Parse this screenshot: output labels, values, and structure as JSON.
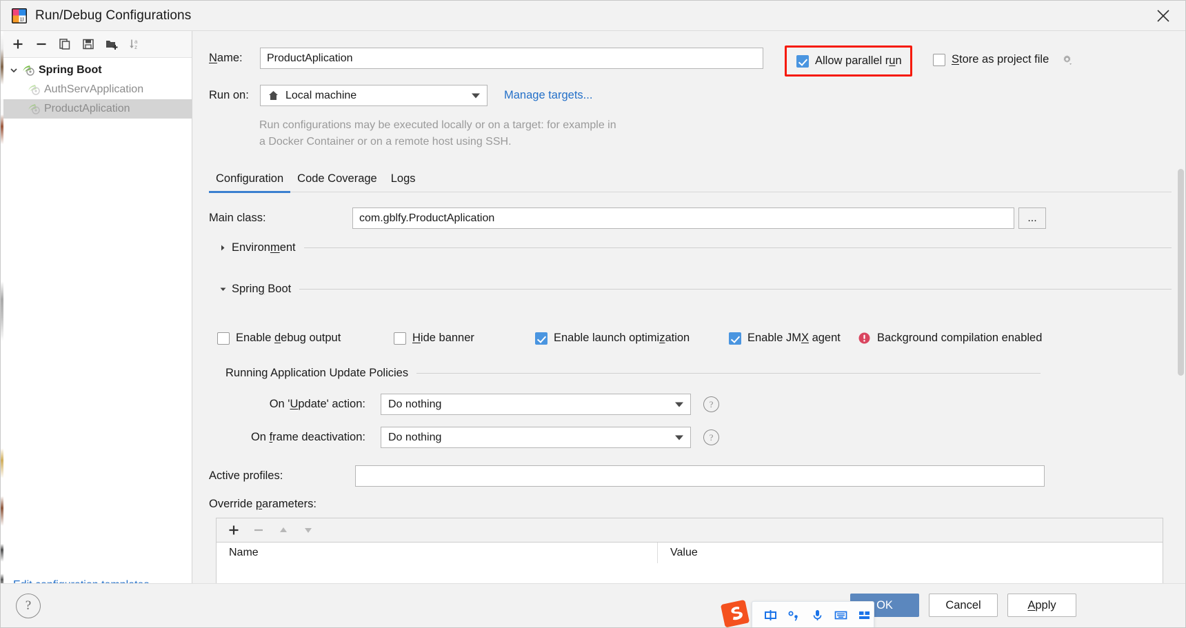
{
  "window": {
    "title": "Run/Debug Configurations",
    "app_icon": "intellij-idea-icon",
    "close_icon": "close-icon"
  },
  "left_panel": {
    "toolbar": [
      {
        "name": "add-configuration-button",
        "icon": "plus-icon"
      },
      {
        "name": "remove-configuration-button",
        "icon": "minus-icon"
      },
      {
        "name": "copy-configuration-button",
        "icon": "copy-icon"
      },
      {
        "name": "save-configuration-button",
        "icon": "save-icon"
      },
      {
        "name": "create-folder-button",
        "icon": "folder-add-icon"
      },
      {
        "name": "sort-configurations-button",
        "icon": "sort-alpha-icon"
      }
    ],
    "tree": [
      {
        "label": "Spring Boot",
        "level": 0,
        "bold": true,
        "expanded": true,
        "selected": false,
        "icon": "spring-boot-icon"
      },
      {
        "label": "AuthServApplication",
        "level": 1,
        "bold": false,
        "selected": false,
        "icon": "spring-boot-icon"
      },
      {
        "label": "ProductAplication",
        "level": 1,
        "bold": false,
        "selected": true,
        "icon": "spring-boot-icon"
      }
    ],
    "edit_templates_link": "Edit configuration templates..."
  },
  "form": {
    "name_label": "Name:",
    "name_value": "ProductAplication",
    "allow_parallel_run": {
      "label": "Allow parallel run",
      "checked": true,
      "highlight_color": "#f61a0a"
    },
    "store_as_project_file": {
      "label": "Store as project file",
      "checked": false,
      "gear_icon": "gear-dropdown-icon"
    },
    "run_on_label": "Run on:",
    "run_on_value": "Local machine",
    "run_on_icon": "home-icon",
    "manage_targets_link": "Manage targets...",
    "hint_text": "Run configurations may be executed locally or on a target: for example in a Docker Container or on a remote host using SSH."
  },
  "tabs": [
    {
      "label": "Configuration",
      "active": true
    },
    {
      "label": "Code Coverage",
      "active": false
    },
    {
      "label": "Logs",
      "active": false
    }
  ],
  "configuration": {
    "main_class_label": "Main class:",
    "main_class_value": "com.gblfy.ProductAplication",
    "browse_button_label": "...",
    "environment_section": {
      "title": "Environment",
      "expanded": false
    },
    "spring_boot_section": {
      "title": "Spring Boot",
      "expanded": true
    },
    "checkboxes": [
      {
        "name": "enable-debug-output",
        "label": "Enable debug output",
        "underline_index": 7,
        "checked": false
      },
      {
        "name": "hide-banner",
        "label": "Hide banner",
        "underline_index": 0,
        "checked": false
      },
      {
        "name": "enable-launch-optimization",
        "label": "Enable launch optimization",
        "underline_index": 20,
        "checked": true
      },
      {
        "name": "enable-jmx-agent",
        "label": "Enable JMX agent",
        "underline_index": 10,
        "checked": true
      }
    ],
    "background_compilation": {
      "text": "Background compilation enabled",
      "icon": "error-warning-icon",
      "icon_color": "#d9455f"
    },
    "update_policies": {
      "section_title": "Running Application Update Policies",
      "rows": [
        {
          "label": "On 'Update' action:",
          "value": "Do nothing",
          "help_icon": "question-icon"
        },
        {
          "label": "On frame deactivation:",
          "value": "Do nothing",
          "help_icon": "question-icon"
        }
      ]
    },
    "active_profiles_label": "Active profiles:",
    "active_profiles_value": "",
    "override_parameters_label": "Override parameters:",
    "override_table": {
      "toolbar": [
        {
          "name": "add-parameter-button",
          "icon": "plus-icon",
          "enabled": true
        },
        {
          "name": "remove-parameter-button",
          "icon": "minus-icon",
          "enabled": false
        },
        {
          "name": "move-up-button",
          "icon": "arrow-up-icon",
          "enabled": false
        },
        {
          "name": "move-down-button",
          "icon": "arrow-down-icon",
          "enabled": false
        }
      ],
      "columns": [
        "Name",
        "Value"
      ],
      "rows": []
    }
  },
  "footer": {
    "help_label": "?",
    "ok_label": "OK",
    "cancel_label": "Cancel",
    "apply_label": "Apply",
    "ok_color": "#5b87be"
  },
  "ime_overlay": {
    "logo_icon": "sogou-logo-icon",
    "buttons": [
      {
        "name": "ime-mode-icon",
        "icon": "chinese-input-icon"
      },
      {
        "name": "ime-punctuation-icon",
        "icon": "punctuation-icon"
      },
      {
        "name": "ime-voice-icon",
        "icon": "microphone-icon"
      },
      {
        "name": "ime-keyboard-icon",
        "icon": "keyboard-icon"
      },
      {
        "name": "ime-toolbox-icon",
        "icon": "toolbox-icon"
      }
    ]
  }
}
